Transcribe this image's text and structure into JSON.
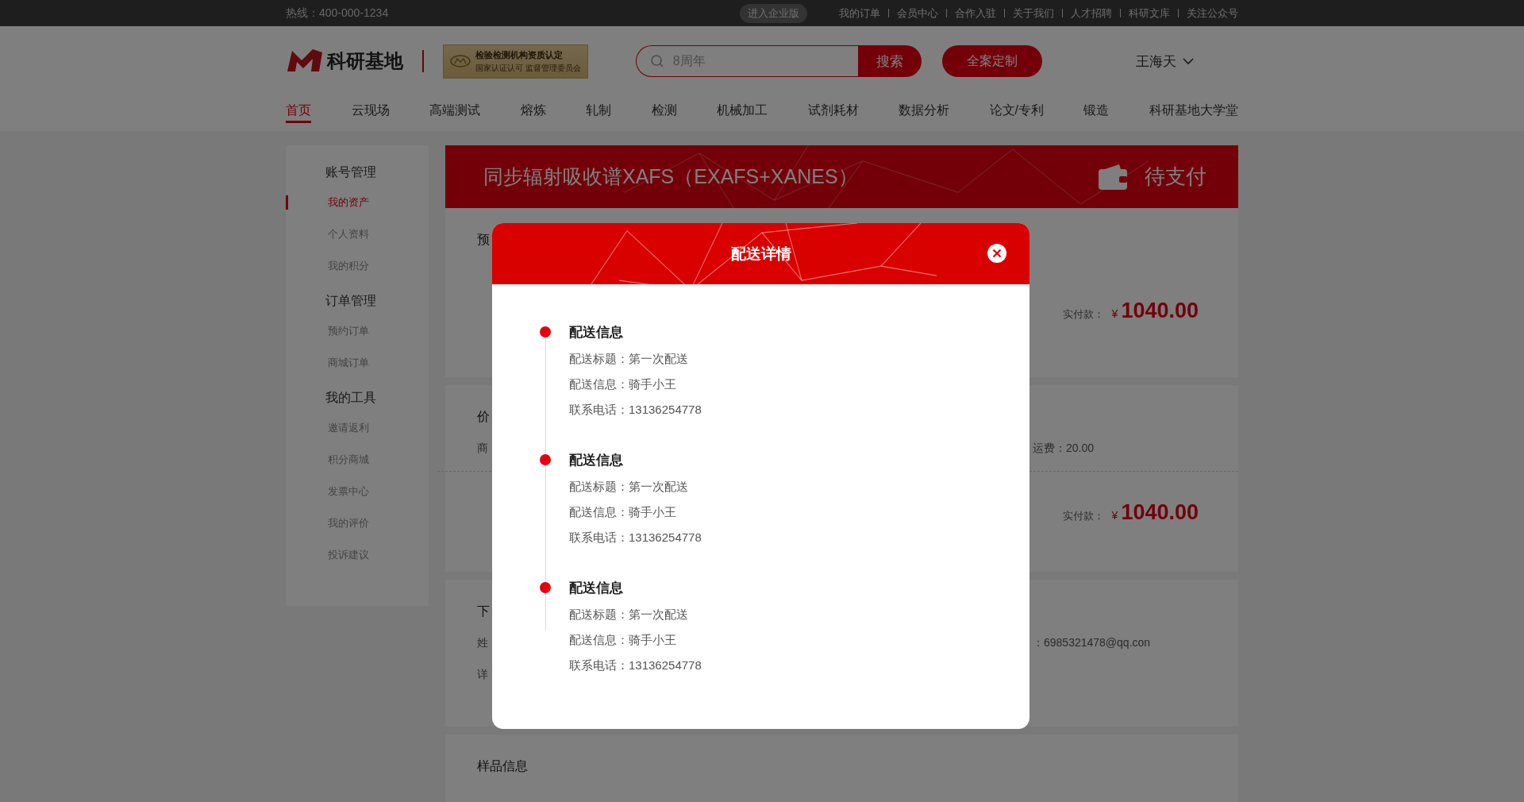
{
  "top_bar": {
    "hotline": "热线：400-000-1234",
    "enterprise_button": "进入企业版",
    "links": [
      "我的订单",
      "会员中心",
      "合作入驻",
      "关于我们",
      "人才招聘",
      "科研文库",
      "关注公众号"
    ]
  },
  "header": {
    "logo_text": "科研基地",
    "cert_title": "检验检测机构资质认定",
    "cert_subtitle": "国家认证认可 监督管理委员会",
    "search": {
      "placeholder": "8周年"
    },
    "search_button": "搜索",
    "custom_button": "全案定制",
    "user_name": "王海天"
  },
  "nav": [
    {
      "label": "首页",
      "selected": true
    },
    {
      "label": "云现场",
      "selected": false
    },
    {
      "label": "高端测试",
      "selected": false
    },
    {
      "label": "熔炼",
      "selected": false
    },
    {
      "label": "轧制",
      "selected": false
    },
    {
      "label": "检测",
      "selected": false
    },
    {
      "label": "机械加工",
      "selected": false
    },
    {
      "label": "试剂耗材",
      "selected": false
    },
    {
      "label": "数据分析",
      "selected": false
    },
    {
      "label": "论文/专利",
      "selected": false
    },
    {
      "label": "锻造",
      "selected": false
    },
    {
      "label": "科研基地大学堂",
      "selected": false
    }
  ],
  "sidebar": [
    {
      "title": "账号管理",
      "items": [
        {
          "label": "我的资产",
          "selected": true
        },
        {
          "label": "个人资料",
          "selected": false
        },
        {
          "label": "我的积分",
          "selected": false
        }
      ]
    },
    {
      "title": "订单管理",
      "items": [
        {
          "label": "预约订单",
          "selected": false
        },
        {
          "label": "商城订单",
          "selected": false
        }
      ]
    },
    {
      "title": "我的工具",
      "items": [
        {
          "label": "邀请返利",
          "selected": false
        },
        {
          "label": "积分商城",
          "selected": false
        },
        {
          "label": "发票中心",
          "selected": false
        },
        {
          "label": "我的评价",
          "selected": false
        },
        {
          "label": "投诉建议",
          "selected": false
        }
      ]
    }
  ],
  "banner": {
    "title": "同步辐射吸收谱XAFS（EXAFS+XANES）",
    "status": "待支付"
  },
  "cards": [
    {
      "heading": "预",
      "payment": {
        "label": "实付款：",
        "currency": "¥",
        "amount": "1040.00"
      }
    },
    {
      "heading": "价",
      "rows": [
        {
          "left": "商",
          "right": "运费：20.00"
        }
      ],
      "payment": {
        "label": "实付款：",
        "currency": "¥",
        "amount": "1040.00"
      }
    },
    {
      "heading": "下",
      "rows": [
        {
          "left": "姓",
          "right": "：6985321478@qq.con"
        },
        {
          "left": "详"
        }
      ]
    },
    {
      "heading": "样品信息"
    }
  ],
  "modal": {
    "title": "配送详情",
    "entries": [
      {
        "title": "配送信息",
        "lines": [
          "配送标题：第一次配送",
          "配送信息：骑手小王",
          "联系电话：13136254778"
        ]
      },
      {
        "title": "配送信息",
        "lines": [
          "配送标题：第一次配送",
          "配送信息：骑手小王",
          "联系电话：13136254778"
        ]
      },
      {
        "title": "配送信息",
        "lines": [
          "配送标题：第一次配送",
          "配送信息：骑手小王",
          "联系电话：13136254778"
        ]
      }
    ]
  }
}
